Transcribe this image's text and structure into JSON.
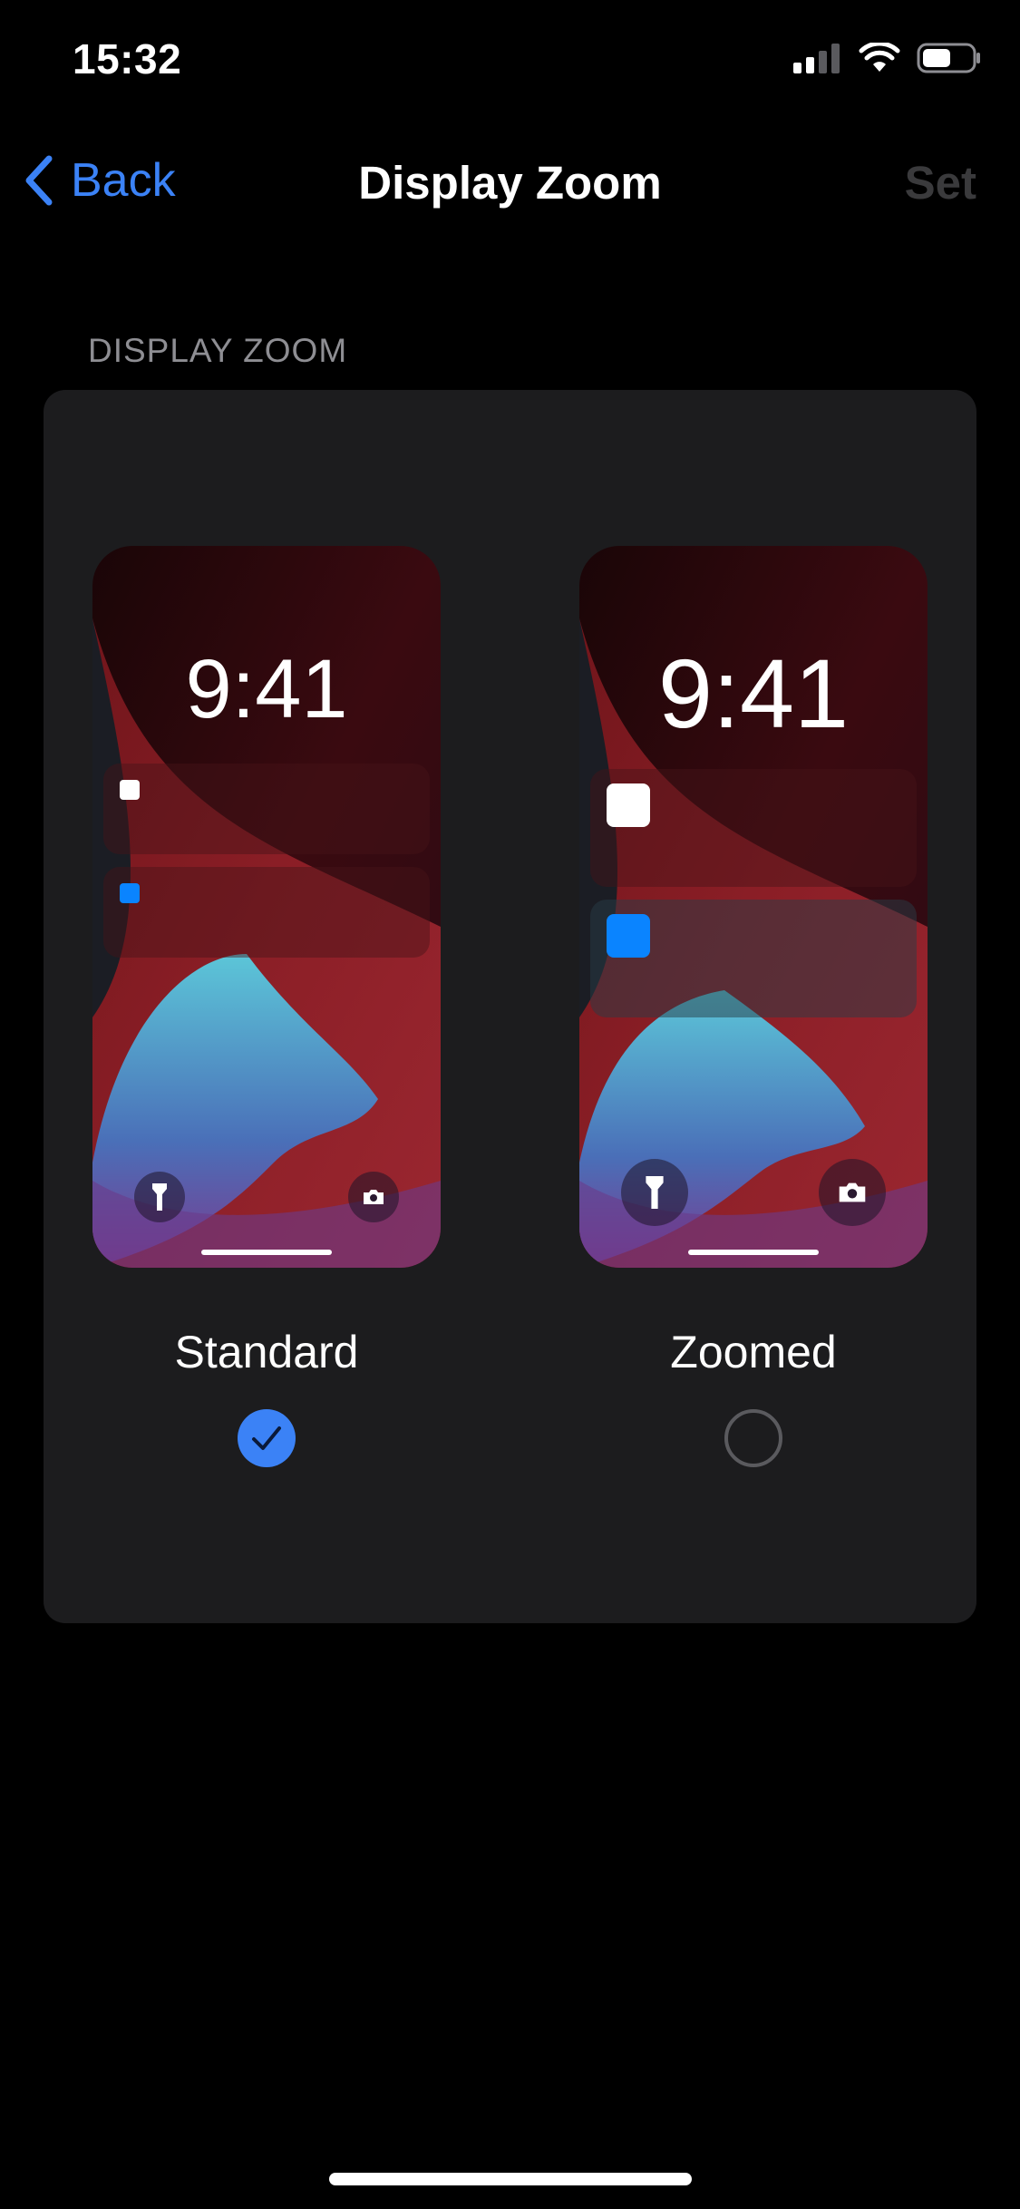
{
  "status_bar": {
    "time": "15:32"
  },
  "nav": {
    "back_label": "Back",
    "title": "Display Zoom",
    "set_label": "Set"
  },
  "section": {
    "header": "DISPLAY ZOOM"
  },
  "options": [
    {
      "label": "Standard",
      "preview_time": "9:41",
      "selected": true
    },
    {
      "label": "Zoomed",
      "preview_time": "9:41",
      "selected": false
    }
  ],
  "colors": {
    "accent": "#3b82f6",
    "card_bg": "#1c1c1e",
    "disabled_text": "#3a3a3c",
    "section_text": "#8e8e93"
  }
}
